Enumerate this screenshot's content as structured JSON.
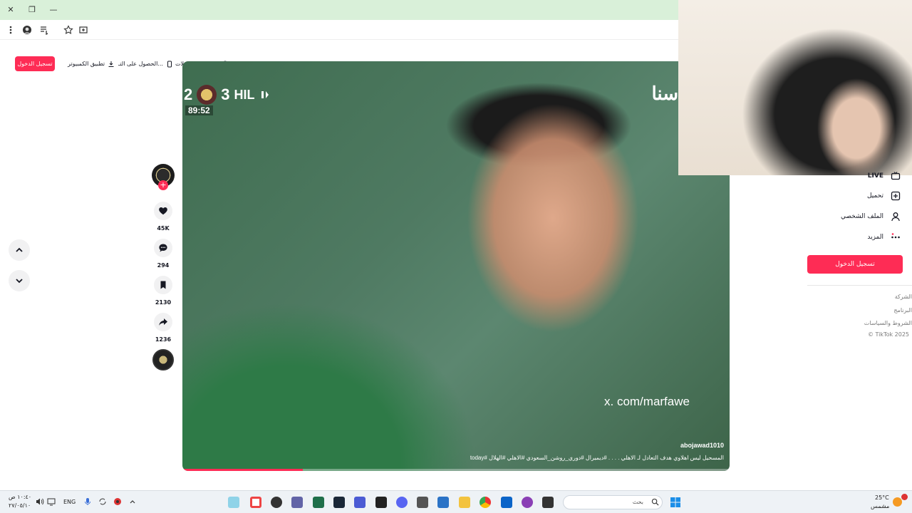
{
  "browser": {
    "close_glyph": "✕",
    "restore_glyph": "❐",
    "minimize_glyph": "—"
  },
  "header": {
    "login_label": "تسجيل الدخول",
    "download_app_label": "تطبيق الكمبيوتر",
    "get_app_label": "الحصول على التـ...",
    "get_coins_label": "احصل على عملات"
  },
  "actions": {
    "follow_plus": "+",
    "likes": "45K",
    "comments": "294",
    "bookmarks": "2130",
    "shares": "1236"
  },
  "video": {
    "score_left": "2",
    "score_right": "3",
    "team": "HIL",
    "match_clock": "89:52",
    "top_right_text": "سنا",
    "watermark": "x. com/marfawe",
    "author": "abojawad1010",
    "caption": "المسحيل ليس اهلاوي هدف التعادل لـ الاهلي . . . . #ديميرال #دوري_روشن_السعودي #الاهلي #الهلال #today",
    "progress": 0.22
  },
  "sidebar": {
    "live_label": "LIVE",
    "upload_label": "تحميل",
    "profile_label": "الملف الشخصي",
    "more_label": "المزيد",
    "login_label": "تسجيل الدخول",
    "footer": {
      "company": "الشركة",
      "program": "البرنامج",
      "terms": "الشروط والسياسات",
      "copyright": "© TikTok 2025"
    }
  },
  "taskbar": {
    "time": "١٠:٤٠ ص",
    "date": "٢٧/٠٥/١٠",
    "language": "ENG",
    "search_placeholder": "بحث",
    "weather_temp": "25°C",
    "weather_desc": "مشمس"
  },
  "colors": {
    "brand": "#fe2c55",
    "titlebar": "#d9f0d9"
  }
}
